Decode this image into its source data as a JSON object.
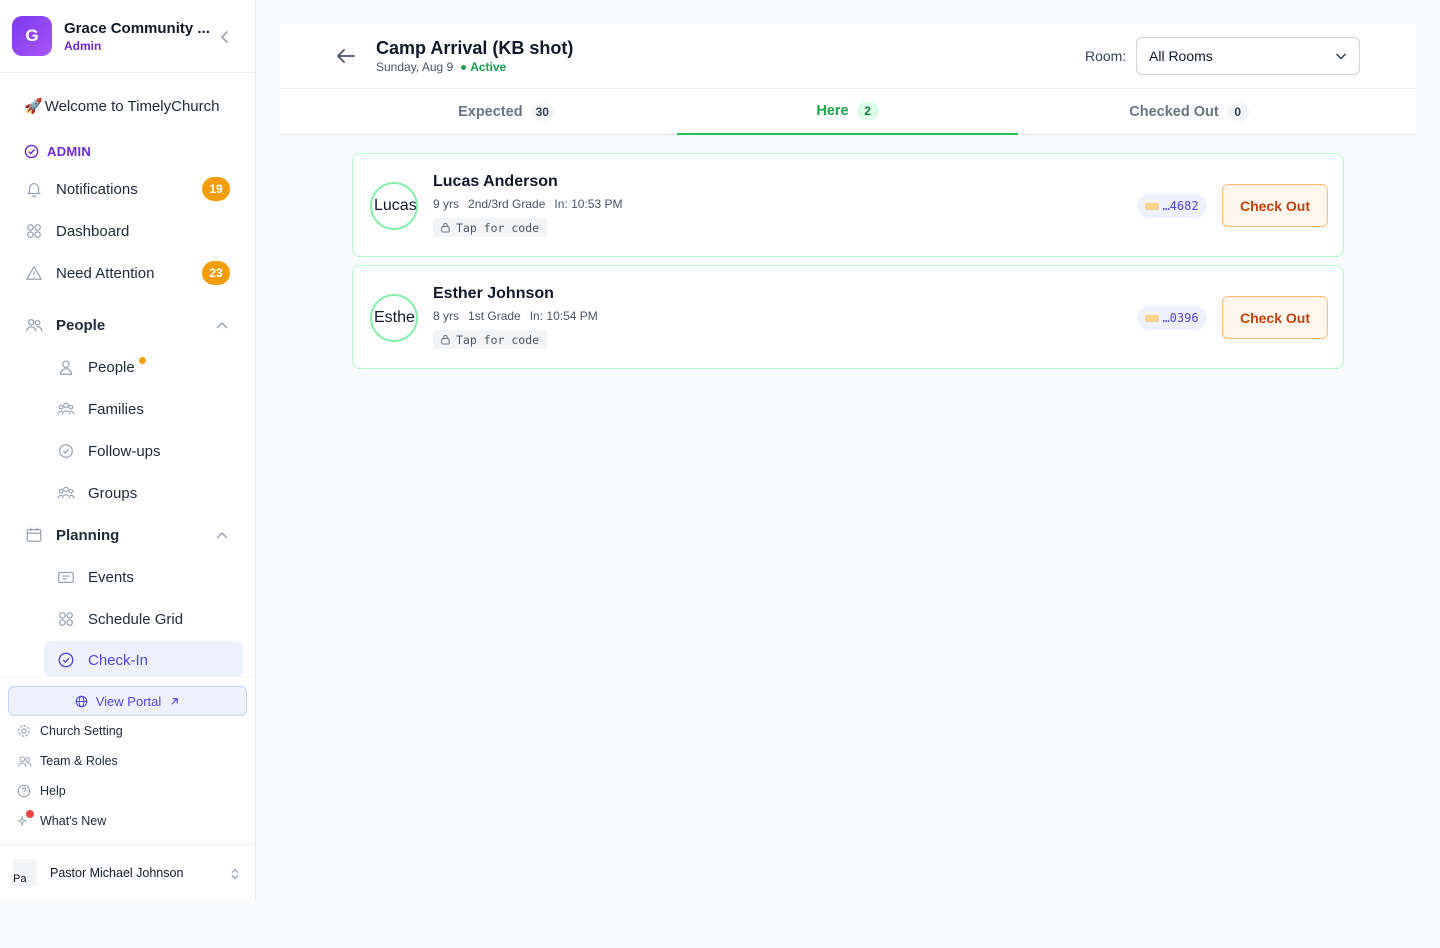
{
  "org": {
    "initial": "G",
    "name": "Grace Community ...",
    "role": "Admin"
  },
  "welcome": {
    "emoji": "🚀",
    "text": "Welcome to TimelyChurch"
  },
  "admin_label": "ADMIN",
  "nav": {
    "notifications": {
      "label": "Notifications",
      "badge": "19"
    },
    "dashboard": {
      "label": "Dashboard"
    },
    "need_attention": {
      "label": "Need Attention",
      "badge": "23"
    },
    "people_section": {
      "label": "People"
    },
    "people_items": [
      "People",
      "Families",
      "Follow-ups",
      "Groups"
    ],
    "planning_section": {
      "label": "Planning"
    },
    "planning_items": [
      "Events",
      "Schedule Grid",
      "Check-In"
    ]
  },
  "bottom": {
    "portal": "View Portal",
    "church_setting": "Church Setting",
    "team_roles": "Team & Roles",
    "help": "Help",
    "whats_new": "What's New",
    "user_name": "Pastor Michael Johnson",
    "user_avatar_alt": "Pa"
  },
  "event": {
    "title": "Camp Arrival (KB shot)",
    "date": "Sunday, Aug 9",
    "status": "Active",
    "room_label": "Room:",
    "room_value": "All Rooms"
  },
  "tabs": [
    {
      "label": "Expected",
      "count": "30"
    },
    {
      "label": "Here",
      "count": "2"
    },
    {
      "label": "Checked Out",
      "count": "0"
    }
  ],
  "children": [
    {
      "name": "Lucas Anderson",
      "avatar_alt": "Lucas",
      "age": "9 yrs",
      "grade": "2nd/3rd Grade",
      "checkin": "In: 10:53 PM",
      "code_label": "Tap for code",
      "tag": "…4682",
      "action": "Check Out"
    },
    {
      "name": "Esther Johnson",
      "avatar_alt": "Esther",
      "age": "8 yrs",
      "grade": "1st Grade",
      "checkin": "In: 10:54 PM",
      "code_label": "Tap for code",
      "tag": "…0396",
      "action": "Check Out"
    }
  ],
  "colors": {
    "brand": "#6d28d9",
    "accent_green": "#16a34a",
    "badge_orange": "#f59e0b",
    "checkout_orange": "#c2410c"
  }
}
